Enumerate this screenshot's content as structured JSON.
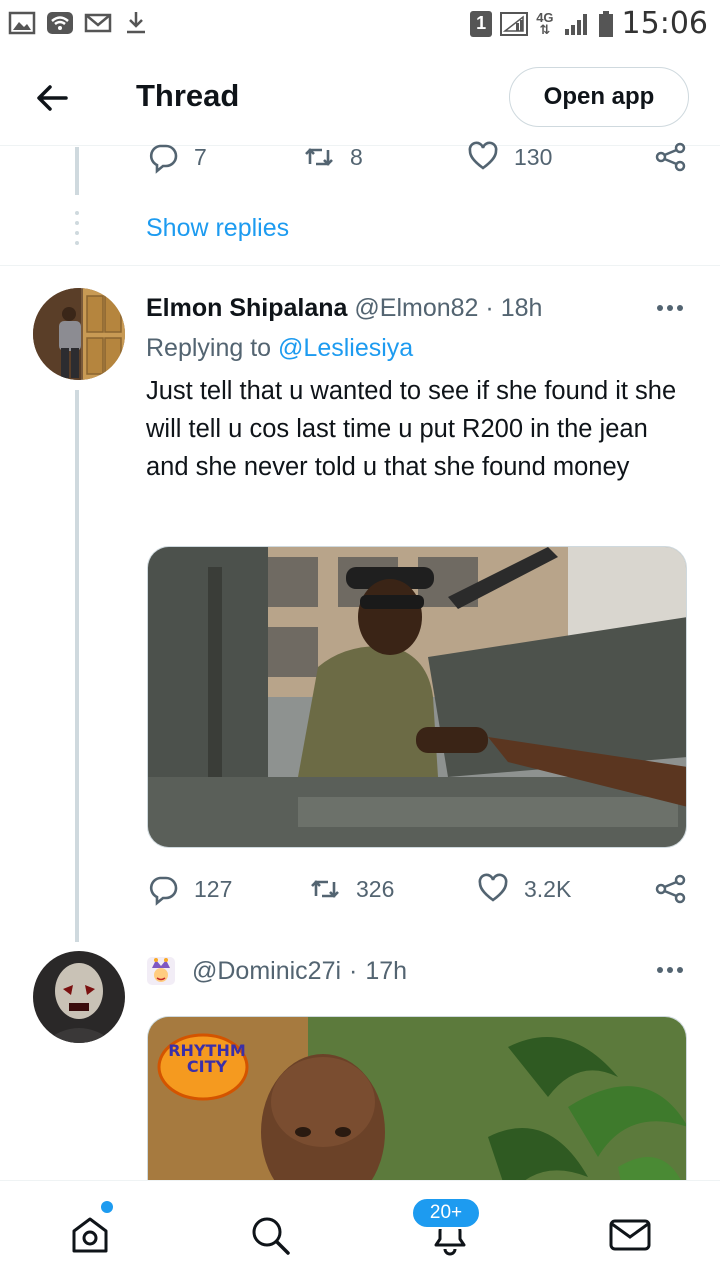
{
  "status_bar": {
    "sim_badge": "1",
    "network": "4G",
    "time": "15:06",
    "icons": [
      "gallery-icon",
      "wifi-icon",
      "mail-icon",
      "download-icon",
      "signal-icon",
      "battery-icon"
    ]
  },
  "header": {
    "title": "Thread",
    "open_app_label": "Open app"
  },
  "previous_tweet": {
    "replies": "7",
    "retweets": "8",
    "likes": "130",
    "show_replies": "Show replies"
  },
  "tweet1": {
    "name": "Elmon Shipalana",
    "handle": "@Elmon82",
    "sep": "·",
    "time": "18h",
    "replying_prefix": "Replying to",
    "replying_to": "@Lesliesiya",
    "text": "Just tell that u wanted to see if she found it she will tell u cos last time u put R200 in the jean  and she never told u that she found money",
    "replies": "127",
    "retweets": "326",
    "likes": "3.2K"
  },
  "tweet2": {
    "handle": "@Dominic27i",
    "sep": "·",
    "time": "17h",
    "logo_text": "RHYTHM CITY"
  },
  "bottom_nav": {
    "notifications_badge": "20+",
    "items": [
      "home-icon",
      "search-icon",
      "notifications-icon",
      "messages-icon"
    ]
  },
  "colors": {
    "accent": "#1d9bf0",
    "text_primary": "#0f1419",
    "text_secondary": "#536471",
    "border": "#cfd9de"
  }
}
